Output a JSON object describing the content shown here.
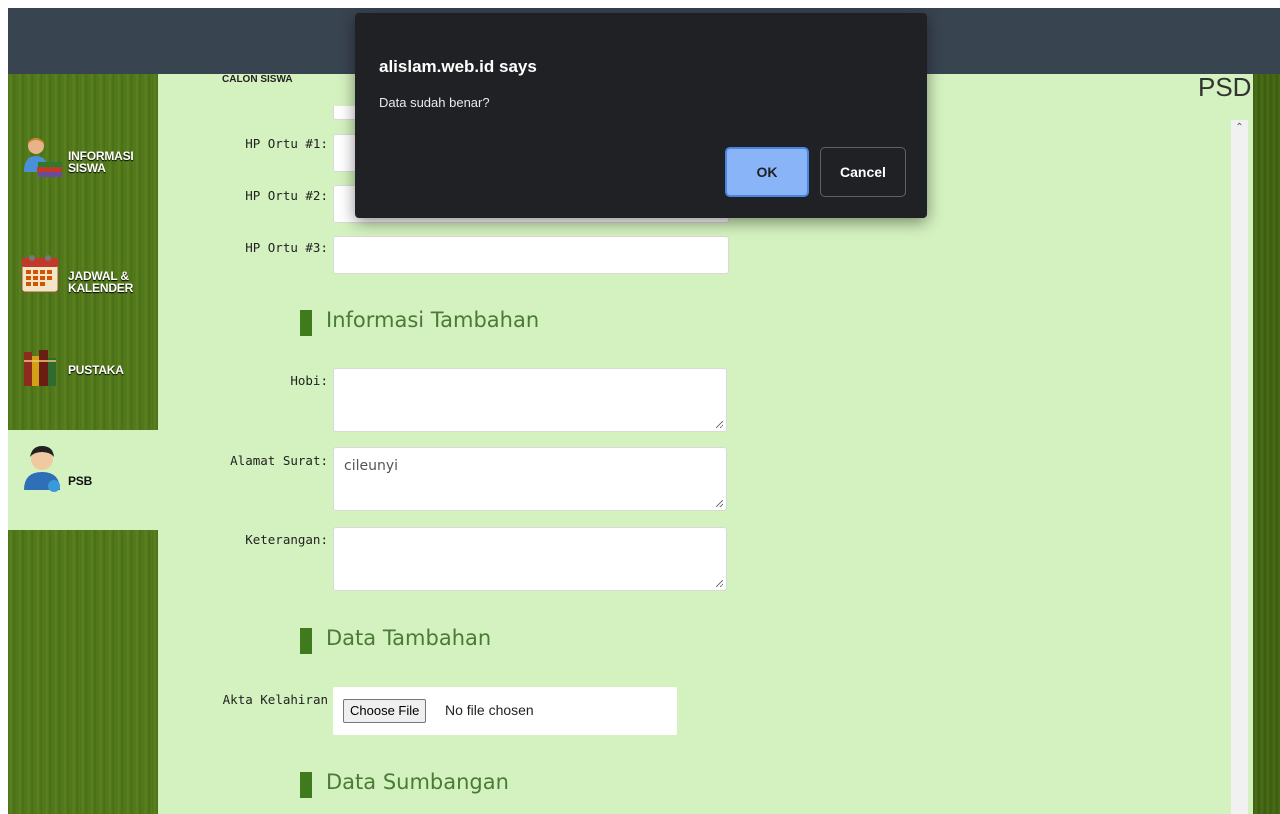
{
  "dialog": {
    "title": "alislam.web.id says",
    "message": "Data sudah benar?",
    "ok_label": "OK",
    "cancel_label": "Cancel"
  },
  "header": {
    "tab_hint": "CALON SISWA",
    "page_code": "PSD"
  },
  "sidebar": {
    "items": [
      {
        "label": "INFORMASI\nSISWA",
        "icon": "student-books-icon"
      },
      {
        "label": "JADWAL &\nKALENDER",
        "icon": "calendar-icon"
      },
      {
        "label": "PUSTAKA",
        "icon": "books-icon"
      },
      {
        "label": "PSB",
        "icon": "user-icon",
        "active": true
      }
    ]
  },
  "form": {
    "hp1_label": "HP Ortu #1:",
    "hp2_label": "HP Ortu #2:",
    "hp3_label": "HP Ortu #3:",
    "section_info": "Informasi Tambahan",
    "hobi_label": "Hobi:",
    "alamat_label": "Alamat Surat:",
    "alamat_value": "cileunyi",
    "keterangan_label": "Keterangan:",
    "section_data": "Data Tambahan",
    "akta_label": "Akta Kelahiran",
    "choose_file_label": "Choose File",
    "no_file_text": "No file chosen",
    "section_sumbangan": "Data Sumbangan"
  },
  "colors": {
    "sidebar": "#557c1d",
    "content": "#d4f2bf",
    "section_bar": "#3f7a1c",
    "dialog_bg": "#202124",
    "ok_button": "#8ab4f8"
  }
}
